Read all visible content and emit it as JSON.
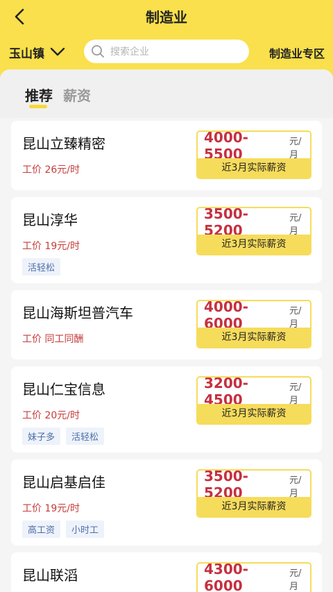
{
  "header": {
    "title": "制造业",
    "location": "玉山镇",
    "search_placeholder": "搜索企业",
    "zone_link": "制造业专区"
  },
  "tabs": [
    {
      "label": "推荐",
      "active": true
    },
    {
      "label": "薪资",
      "active": false
    }
  ],
  "companies": [
    {
      "name": "昆山立臻精密",
      "wage": "工价 26元/时",
      "salary": "4000-5500",
      "unit": "元/月",
      "note": "近3月实际薪资",
      "tags": []
    },
    {
      "name": "昆山淳华",
      "wage": "工价 19元/时",
      "salary": "3500-5200",
      "unit": "元/月",
      "note": "近3月实际薪资",
      "tags": [
        "活轻松"
      ]
    },
    {
      "name": "昆山海斯坦普汽车",
      "wage": "工价 同工同酬",
      "salary": "4000-6000",
      "unit": "元/月",
      "note": "近3月实际薪资",
      "tags": []
    },
    {
      "name": "昆山仁宝信息",
      "wage": "工价 20元/时",
      "salary": "3200-4500",
      "unit": "元/月",
      "note": "近3月实际薪资",
      "tags": [
        "妹子多",
        "活轻松"
      ]
    },
    {
      "name": "昆山启基启佳",
      "wage": "工价 19元/时",
      "salary": "3500-5200",
      "unit": "元/月",
      "note": "近3月实际薪资",
      "tags": [
        "高工资",
        "小时工"
      ]
    },
    {
      "name": "昆山联滔",
      "wage": "",
      "salary": "4300-6000",
      "unit": "元/月",
      "note": "",
      "tags": []
    }
  ],
  "colors": {
    "brand_yellow": "#f9e04c",
    "salary_red": "#c6303f",
    "wage_red": "#c63b3b",
    "tag_blue": "#4d6fa7"
  }
}
